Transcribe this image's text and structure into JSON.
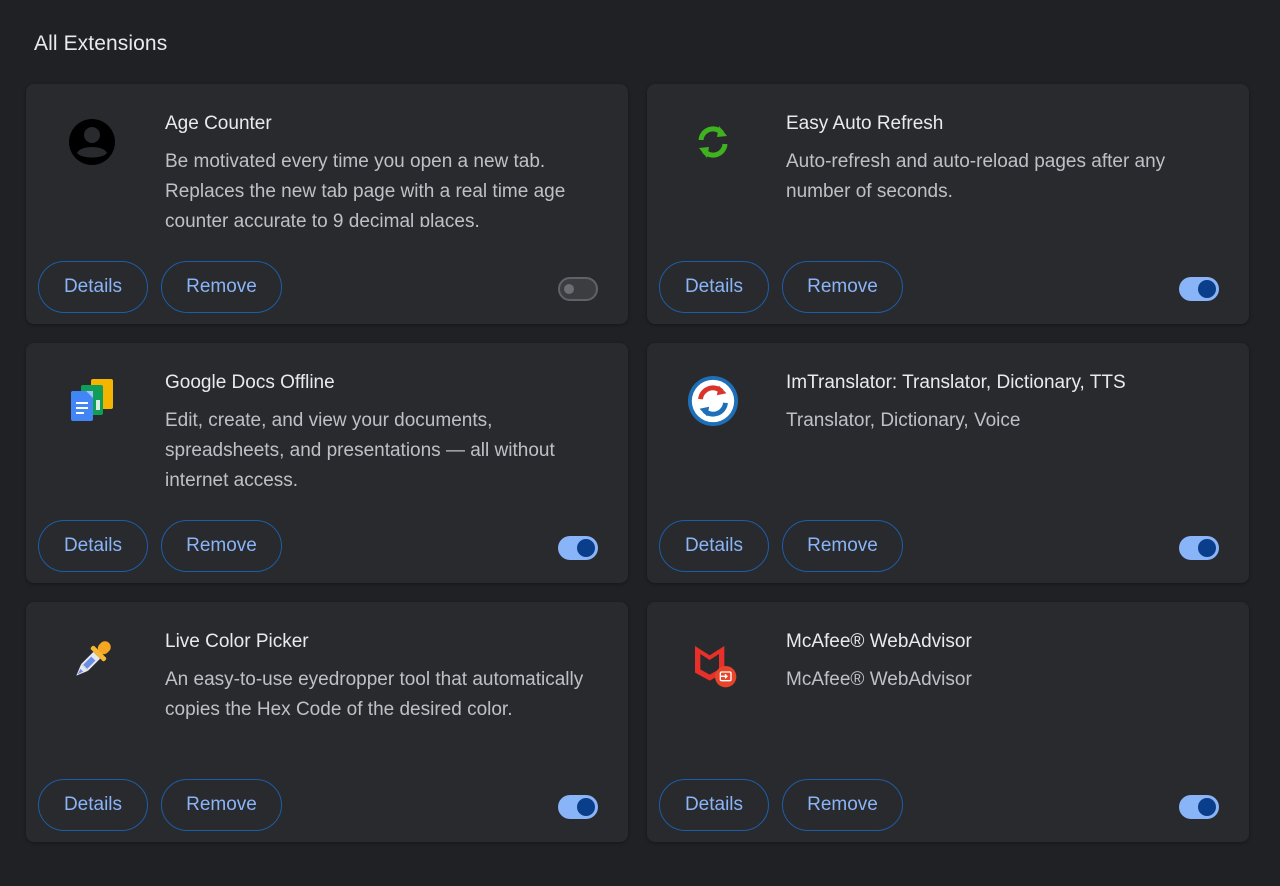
{
  "section_title": "All Extensions",
  "extensions": [
    {
      "name": "Age Counter",
      "description": "Be motivated every time you open a new tab. Replaces the new tab page with a real time age counter accurate to 9 decimal places.",
      "icon": "person-avatar-icon",
      "details_label": "Details",
      "remove_label": "Remove",
      "enabled": false
    },
    {
      "name": "Easy Auto Refresh",
      "description": "Auto-refresh and auto-reload pages after any number of seconds.",
      "icon": "refresh-arrows-icon",
      "details_label": "Details",
      "remove_label": "Remove",
      "enabled": true
    },
    {
      "name": "Google Docs Offline",
      "description": "Edit, create, and view your documents, spreadsheets, and presentations — all without internet access.",
      "icon": "google-docs-icon",
      "details_label": "Details",
      "remove_label": "Remove",
      "enabled": true
    },
    {
      "name": "ImTranslator: Translator, Dictionary, TTS",
      "description": "Translator, Dictionary, Voice",
      "icon": "imtranslator-icon",
      "details_label": "Details",
      "remove_label": "Remove",
      "enabled": true
    },
    {
      "name": "Live Color Picker",
      "description": "An easy-to-use eyedropper tool that automatically copies the Hex Code of the desired color.",
      "icon": "eyedropper-icon",
      "details_label": "Details",
      "remove_label": "Remove",
      "enabled": true
    },
    {
      "name": "McAfee® WebAdvisor",
      "description": "McAfee® WebAdvisor",
      "icon": "mcafee-icon",
      "details_label": "Details",
      "remove_label": "Remove",
      "enabled": true
    }
  ],
  "colors": {
    "background": "#202124",
    "card": "#292a2d",
    "accent": "#8ab4f8",
    "toggle_knob_on": "#0b3e8a"
  }
}
